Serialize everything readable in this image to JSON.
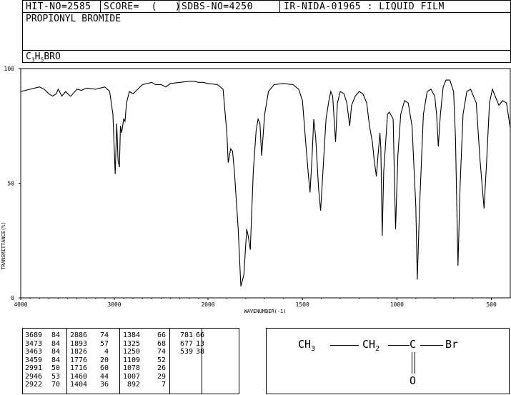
{
  "header": {
    "hit_no": "HIT-NO=2585",
    "score": "SCORE=  (   )",
    "sdbs_no": "SDBS-NO=4250",
    "ir_info": "IR-NIDA-01965 : LIQUID FILM"
  },
  "compound": {
    "name": "PROPIONYL BROMIDE",
    "formula_parts": [
      "C",
      "3",
      "H",
      "5",
      "BRO"
    ]
  },
  "chart_data": {
    "type": "line",
    "xlabel": "WAVENUMBER(-1)",
    "ylabel": "TRANSMITTANCE(%)",
    "xlim": [
      4000,
      400
    ],
    "ylim": [
      0,
      100
    ],
    "x_ticks": [
      "4000",
      "3000",
      "2000",
      "1500",
      "1000",
      "500"
    ],
    "y_ticks": [
      "100",
      "50",
      "0"
    ],
    "series": [
      {
        "points": [
          [
            4000,
            90
          ],
          [
            3900,
            91
          ],
          [
            3800,
            92
          ],
          [
            3750,
            91
          ],
          [
            3700,
            89
          ],
          [
            3660,
            88
          ],
          [
            3640,
            88.5
          ],
          [
            3620,
            89
          ],
          [
            3600,
            91
          ],
          [
            3560,
            88
          ],
          [
            3520,
            90
          ],
          [
            3473,
            88
          ],
          [
            3463,
            88
          ],
          [
            3400,
            91
          ],
          [
            3350,
            90.5
          ],
          [
            3300,
            91.5
          ],
          [
            3200,
            91
          ],
          [
            3100,
            92
          ],
          [
            3050,
            90
          ],
          [
            3015,
            80
          ],
          [
            2991,
            54
          ],
          [
            2975,
            76
          ],
          [
            2960,
            60
          ],
          [
            2946,
            57
          ],
          [
            2935,
            75
          ],
          [
            2922,
            72
          ],
          [
            2900,
            78
          ],
          [
            2886,
            77
          ],
          [
            2870,
            85
          ],
          [
            2840,
            90
          ],
          [
            2800,
            89
          ],
          [
            2750,
            91
          ],
          [
            2700,
            93
          ],
          [
            2600,
            94
          ],
          [
            2560,
            93
          ],
          [
            2500,
            93
          ],
          [
            2450,
            92
          ],
          [
            2400,
            93.5
          ],
          [
            2300,
            94
          ],
          [
            2200,
            94.5
          ],
          [
            2150,
            94.5
          ],
          [
            2100,
            94
          ],
          [
            2050,
            94
          ],
          [
            2000,
            93.5
          ],
          [
            1950,
            93
          ],
          [
            1920,
            91
          ],
          [
            1900,
            72
          ],
          [
            1893,
            59
          ],
          [
            1880,
            65
          ],
          [
            1870,
            64
          ],
          [
            1860,
            55
          ],
          [
            1840,
            30
          ],
          [
            1826,
            5
          ],
          [
            1810,
            10
          ],
          [
            1795,
            30
          ],
          [
            1787,
            27
          ],
          [
            1776,
            21
          ],
          [
            1760,
            55
          ],
          [
            1745,
            73
          ],
          [
            1735,
            78
          ],
          [
            1725,
            76
          ],
          [
            1716,
            62
          ],
          [
            1700,
            80
          ],
          [
            1680,
            90
          ],
          [
            1650,
            93
          ],
          [
            1600,
            93.5
          ],
          [
            1550,
            93
          ],
          [
            1520,
            91
          ],
          [
            1500,
            86
          ],
          [
            1485,
            70
          ],
          [
            1470,
            55
          ],
          [
            1460,
            46
          ],
          [
            1450,
            60
          ],
          [
            1440,
            78
          ],
          [
            1430,
            70
          ],
          [
            1415,
            48
          ],
          [
            1404,
            38
          ],
          [
            1395,
            50
          ],
          [
            1384,
            66
          ],
          [
            1375,
            78
          ],
          [
            1360,
            86
          ],
          [
            1350,
            90
          ],
          [
            1340,
            88
          ],
          [
            1325,
            68
          ],
          [
            1315,
            85
          ],
          [
            1300,
            90
          ],
          [
            1280,
            89
          ],
          [
            1265,
            85
          ],
          [
            1250,
            75
          ],
          [
            1240,
            84
          ],
          [
            1220,
            88
          ],
          [
            1200,
            90
          ],
          [
            1180,
            89
          ],
          [
            1160,
            85
          ],
          [
            1145,
            75
          ],
          [
            1130,
            68
          ],
          [
            1120,
            60
          ],
          [
            1109,
            53
          ],
          [
            1100,
            62
          ],
          [
            1090,
            72
          ],
          [
            1085,
            65
          ],
          [
            1078,
            27
          ],
          [
            1070,
            55
          ],
          [
            1050,
            80
          ],
          [
            1040,
            81
          ],
          [
            1020,
            78
          ],
          [
            1007,
            30
          ],
          [
            995,
            62
          ],
          [
            980,
            80
          ],
          [
            960,
            86
          ],
          [
            940,
            85
          ],
          [
            920,
            75
          ],
          [
            900,
            40
          ],
          [
            892,
            8
          ],
          [
            880,
            40
          ],
          [
            860,
            80
          ],
          [
            840,
            90
          ],
          [
            820,
            91
          ],
          [
            800,
            88
          ],
          [
            790,
            80
          ],
          [
            781,
            66
          ],
          [
            770,
            80
          ],
          [
            755,
            92
          ],
          [
            740,
            95
          ],
          [
            720,
            95
          ],
          [
            700,
            90
          ],
          [
            690,
            70
          ],
          [
            677,
            14
          ],
          [
            665,
            50
          ],
          [
            650,
            80
          ],
          [
            630,
            90
          ],
          [
            610,
            91
          ],
          [
            580,
            85
          ],
          [
            560,
            60
          ],
          [
            545,
            45
          ],
          [
            539,
            39
          ],
          [
            525,
            60
          ],
          [
            510,
            85
          ],
          [
            495,
            91
          ],
          [
            480,
            88
          ],
          [
            460,
            84
          ],
          [
            440,
            86
          ],
          [
            420,
            85
          ],
          [
            400,
            74
          ]
        ]
      }
    ]
  },
  "peaks_table": [
    [
      "3689",
      "84",
      "2886",
      "74",
      "1384",
      "66",
      "781",
      "66"
    ],
    [
      "3473",
      "84",
      "1893",
      "57",
      "1325",
      "68",
      "677",
      "13"
    ],
    [
      "3463",
      "84",
      "1826",
      "4",
      "1250",
      "74",
      "539",
      "38"
    ],
    [
      "3459",
      "84",
      "1776",
      "20",
      "1109",
      "52",
      "",
      ""
    ],
    [
      "2991",
      "50",
      "1716",
      "60",
      "1078",
      "26",
      "",
      ""
    ],
    [
      "2946",
      "53",
      "1460",
      "44",
      "1007",
      "29",
      "",
      ""
    ],
    [
      "2922",
      "70",
      "1404",
      "36",
      "892",
      "7",
      "",
      ""
    ]
  ],
  "structure": {
    "ch3": "CH",
    "ch3_sub": "3",
    "ch2": "CH",
    "ch2_sub": "2",
    "c": "C",
    "br": "Br",
    "o": "O"
  }
}
